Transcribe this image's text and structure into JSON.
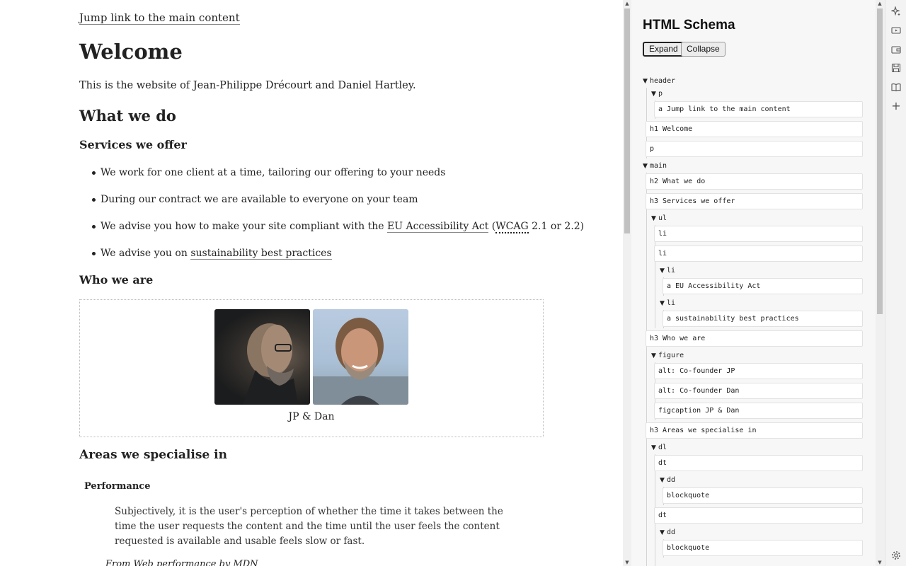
{
  "page": {
    "skip_link": "Jump link to the main content",
    "title": "Welcome",
    "intro": "This is the website of Jean-Philippe Drécourt and Daniel Hartley.",
    "what_we_do": "What we do",
    "services_heading": "Services we offer",
    "services": {
      "item1": "We work for one client at a time, tailoring our offering to your needs",
      "item2": "During our contract we are available to everyone on your team",
      "item3_pre": "We advise you how to make your site compliant with the ",
      "item3_link": "EU Accessibility Act",
      "item3_mid": " (",
      "item3_abbr": "WCAG",
      "item3_post": " 2.1 or 2.2)",
      "item4_pre": "We advise you on ",
      "item4_link": "sustainability best practices"
    },
    "who_heading": "Who we are",
    "figcaption": "JP & Dan",
    "areas_heading": "Areas we specialise in",
    "dt_performance": "Performance",
    "quote": "Subjectively, it is the user's perception of whether the time it takes between the time the user requests the content and the time until the user feels the content requested is available and usable feels slow or fast.",
    "cite": "From Web performance by MDN"
  },
  "panel": {
    "title": "HTML Schema",
    "expand": "Expand",
    "collapse": "Collapse",
    "nodes": {
      "header": "header",
      "p1": "p",
      "a_skip": "a Jump link to the main content",
      "h1": "h1 Welcome",
      "p2": "p",
      "main": "main",
      "h2": "h2 What we do",
      "h3_services": "h3 Services we offer",
      "ul": "ul",
      "li1": "li",
      "li2": "li",
      "li3": "li",
      "a_eu": "a EU Accessibility Act",
      "li4": "li",
      "a_sus": "a sustainability best practices",
      "h3_who": "h3 Who we are",
      "figure": "figure",
      "alt_jp": "alt: Co-founder JP",
      "alt_dan": "alt: Co-founder Dan",
      "figcaption": "figcaption JP & Dan",
      "h3_areas": "h3 Areas we specialise in",
      "dl": "dl",
      "dt1": "dt",
      "dd1": "dd",
      "bq1": "blockquote",
      "dt2": "dt",
      "dd2": "dd",
      "bq2": "blockquote"
    }
  },
  "icons": {
    "rail": [
      "sparkle-icon",
      "video-icon",
      "wallet-icon",
      "save-icon",
      "book-icon",
      "plus-icon",
      "settings-icon"
    ]
  }
}
